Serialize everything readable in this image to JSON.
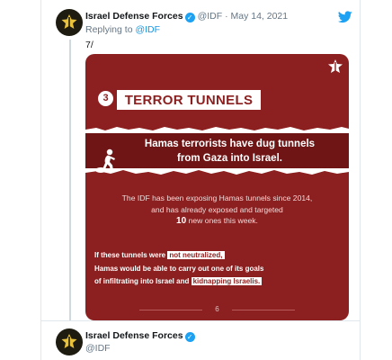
{
  "tweet1": {
    "author_name": "Israel Defense Forces",
    "handle": "@IDF",
    "separator": "·",
    "date": "May 14, 2021",
    "replying_label": "Replying to",
    "replying_handle": "@IDF",
    "thread_count": "7/"
  },
  "poster": {
    "number": "3",
    "title": "TERROR TUNNELS",
    "headline_line1": "Hamas terrorists have dug tunnels",
    "headline_line2": "from Gaza into Israel.",
    "body_line1": "The IDF has been exposing Hamas tunnels since 2014,",
    "body_line2": "and has already exposed and targeted",
    "body_big": "10",
    "body_line3_rest": "new ones this week.",
    "warn1_pre": "If these tunnels were",
    "warn1_hl": "not neutralized,",
    "warn2": "Hamas would be able to carry out one of its goals",
    "warn3_pre": "of infiltrating into Israel and",
    "warn3_hl": "kidnapping Israelis.",
    "page_number": "6",
    "colors": {
      "background": "#8c1f1f",
      "band": "#6f1515",
      "text": "#ffffff"
    }
  },
  "tweet2": {
    "author_name": "Israel Defense Forces",
    "handle": "@IDF"
  },
  "icons": {
    "twitter": "twitter-bird-icon",
    "verified": "verified-badge-icon",
    "star": "idf-emblem-icon"
  },
  "accent_color": "#1da1f2"
}
